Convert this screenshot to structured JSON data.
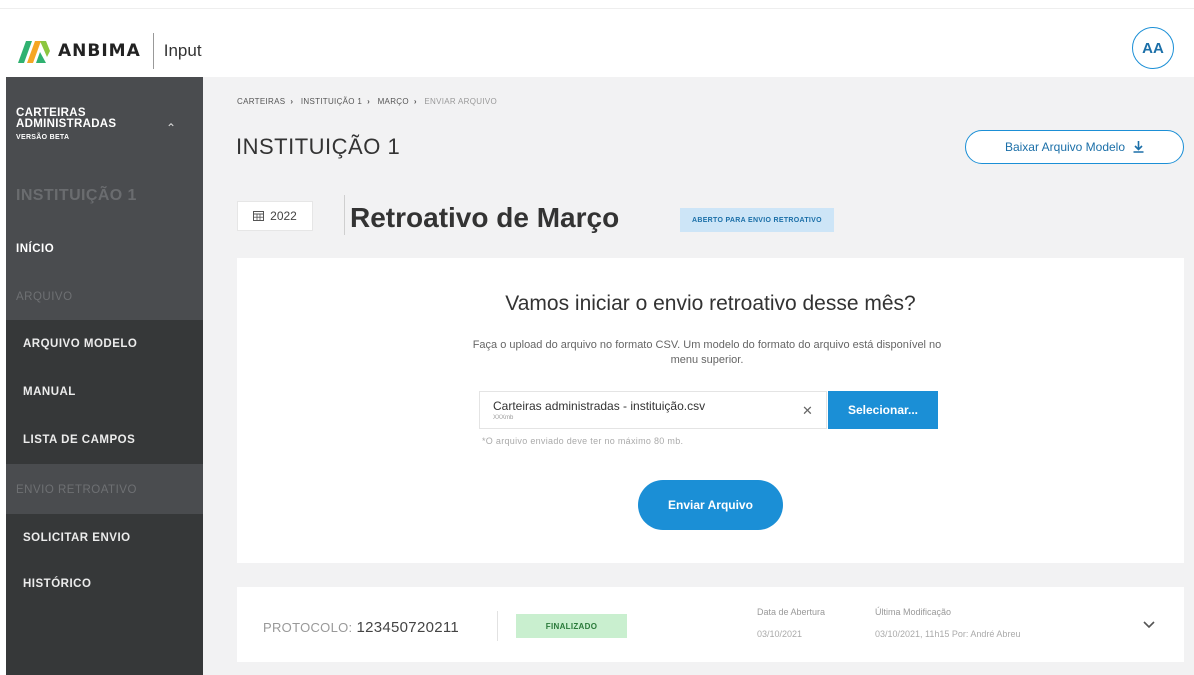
{
  "header": {
    "brand": "ANBIMA",
    "app_name": "Input",
    "avatar_initials": "AA"
  },
  "sidebar": {
    "title": "CARTEIRAS ADMINISTRADAS",
    "subtitle": "VERSÃO BETA",
    "institution": "INSTITUIÇÃO 1",
    "home": "INÍCIO",
    "section_file": "ARQUIVO",
    "file_items": [
      "ARQUIVO MODELO",
      "MANUAL",
      "LISTA DE CAMPOS"
    ],
    "section_retro": "ENVIO RETROATIVO",
    "retro_items": [
      "SOLICITAR ENVIO",
      "HISTÓRICO"
    ]
  },
  "main": {
    "breadcrumb": [
      "CARTEIRAS",
      "INSTITUIÇÃO 1",
      "MARÇO",
      "ENVIAR ARQUIVO"
    ],
    "title": "INSTITUIÇÃO 1",
    "download_button": "Baixar Arquivo Modelo",
    "year": "2022",
    "month_title": "Retroativo de Março",
    "status_badge": "ABERTO PARA ENVIO RETROATIVO",
    "upload": {
      "heading": "Vamos iniciar o envio retroativo desse mês?",
      "description": "Faça o upload do arquivo no formato CSV. Um modelo do formato do arquivo está disponível no menu superior.",
      "file_name": "Carteiras administradas - instituição.csv",
      "file_size": "XXXmb",
      "select_button": "Selecionar...",
      "note": "*O arquivo enviado deve ter no máximo 80 mb.",
      "send_button": "Enviar Arquivo"
    },
    "protocol": {
      "label": "PROTOCOLO:",
      "number": "123450720211",
      "status": "FINALIZADO",
      "opening_label": "Data de Abertura",
      "opening_date": "03/10/2021",
      "modified_label": "Última Modificação",
      "modified_value": "03/10/2021, 11h15 Por: André Abreu"
    }
  },
  "colors": {
    "accent": "#1b8fd6",
    "sidebar": "#4a4c4f",
    "sidebar_sub": "#363839",
    "badge_blue": "#cde5f7",
    "badge_green": "#c9efcf",
    "logo_green": "#2fb170",
    "logo_orange": "#f5a623"
  }
}
